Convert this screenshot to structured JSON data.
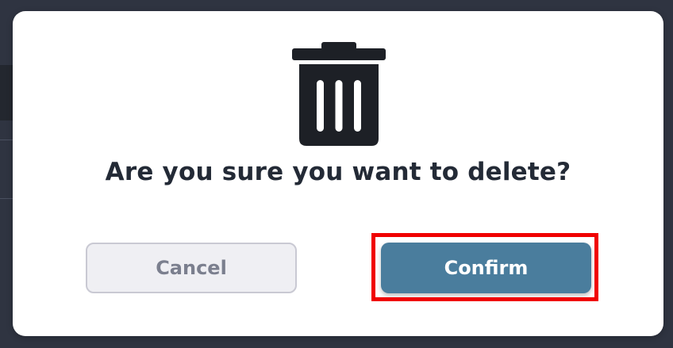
{
  "dialog": {
    "icon": "trash-icon",
    "title": "Are you sure you want to delete?",
    "cancel_label": "Cancel",
    "confirm_label": "Confirm"
  },
  "colors": {
    "overlay_background": "#2f3441",
    "modal_background": "#ffffff",
    "title_text": "#232a36",
    "icon": "#1d2026",
    "cancel_background": "#efeff3",
    "cancel_text": "#7b7f8e",
    "confirm_background": "#4a7d9d",
    "confirm_text": "#ffffff",
    "highlight_border": "#f00000"
  }
}
